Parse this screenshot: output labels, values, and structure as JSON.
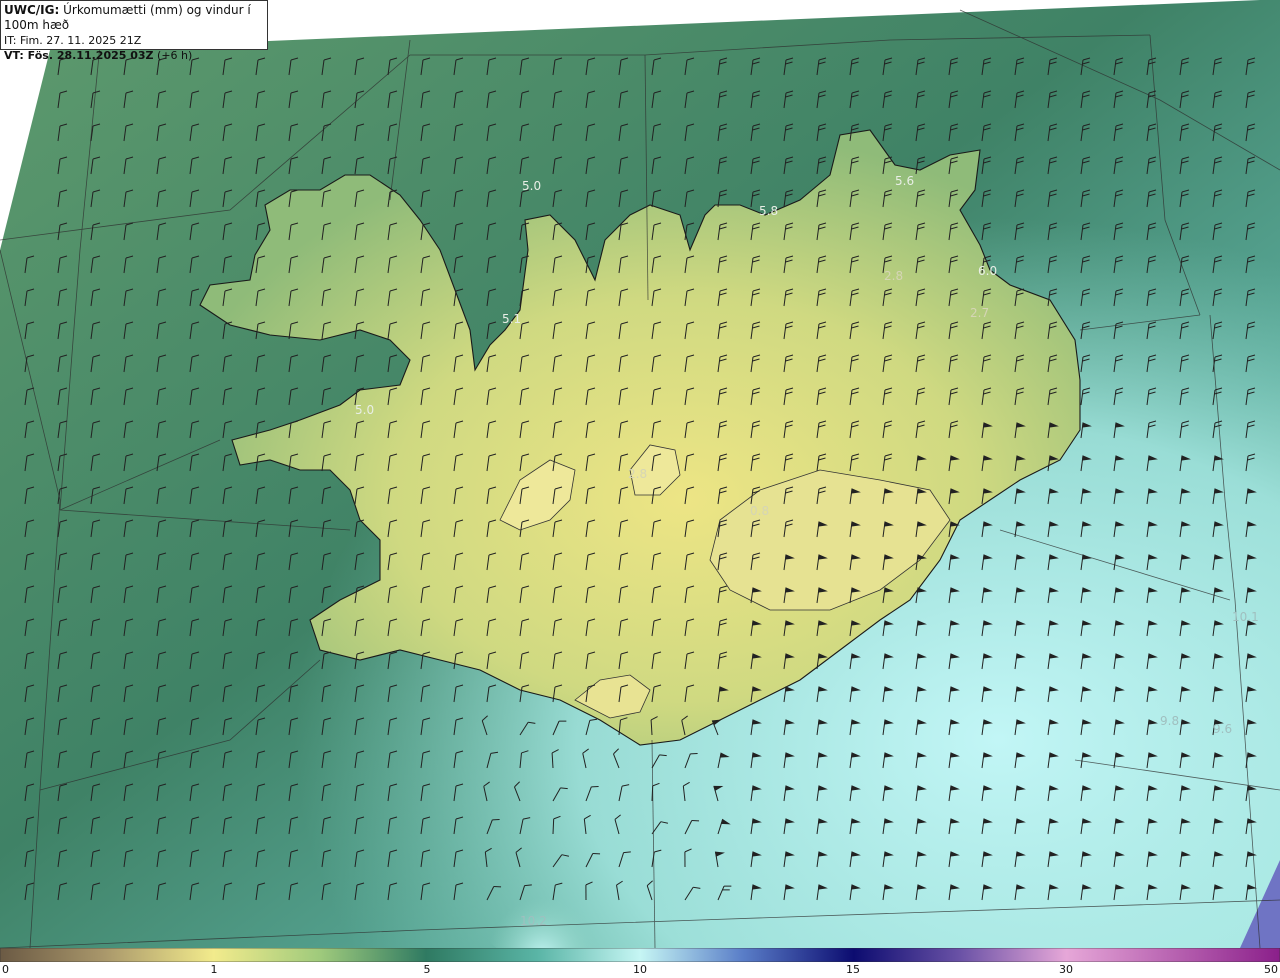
{
  "header": {
    "model": "UWC/IG:",
    "product": " Úrkomumætti (mm) og vindur í 100m hæð",
    "init_time": "IT: Fim. 27. 11. 2025 21Z",
    "valid_prefix": "VT: Fös. 28.11.2025 03Z",
    "valid_suffix": " (+6 h)"
  },
  "map_labels": [
    "5.0",
    "5.8",
    "5.6",
    "6.0",
    "2.8",
    "2.7",
    "5.1",
    "5.0",
    "2.8",
    "0.8",
    "10.1",
    "9.8",
    "9.6",
    "10.2"
  ],
  "colors": {
    "land_low": "#e8e08a",
    "land_mid": "#b9cf7a",
    "sea_west": "#4f8f6a",
    "sea_southeast": "#b6f0ef",
    "coastline": "#1a1a1a",
    "grid": "#333333",
    "barb": "#222222"
  },
  "colorbar": {
    "ticks": [
      "0",
      "1",
      "5",
      "10",
      "15",
      "30",
      "50"
    ]
  }
}
